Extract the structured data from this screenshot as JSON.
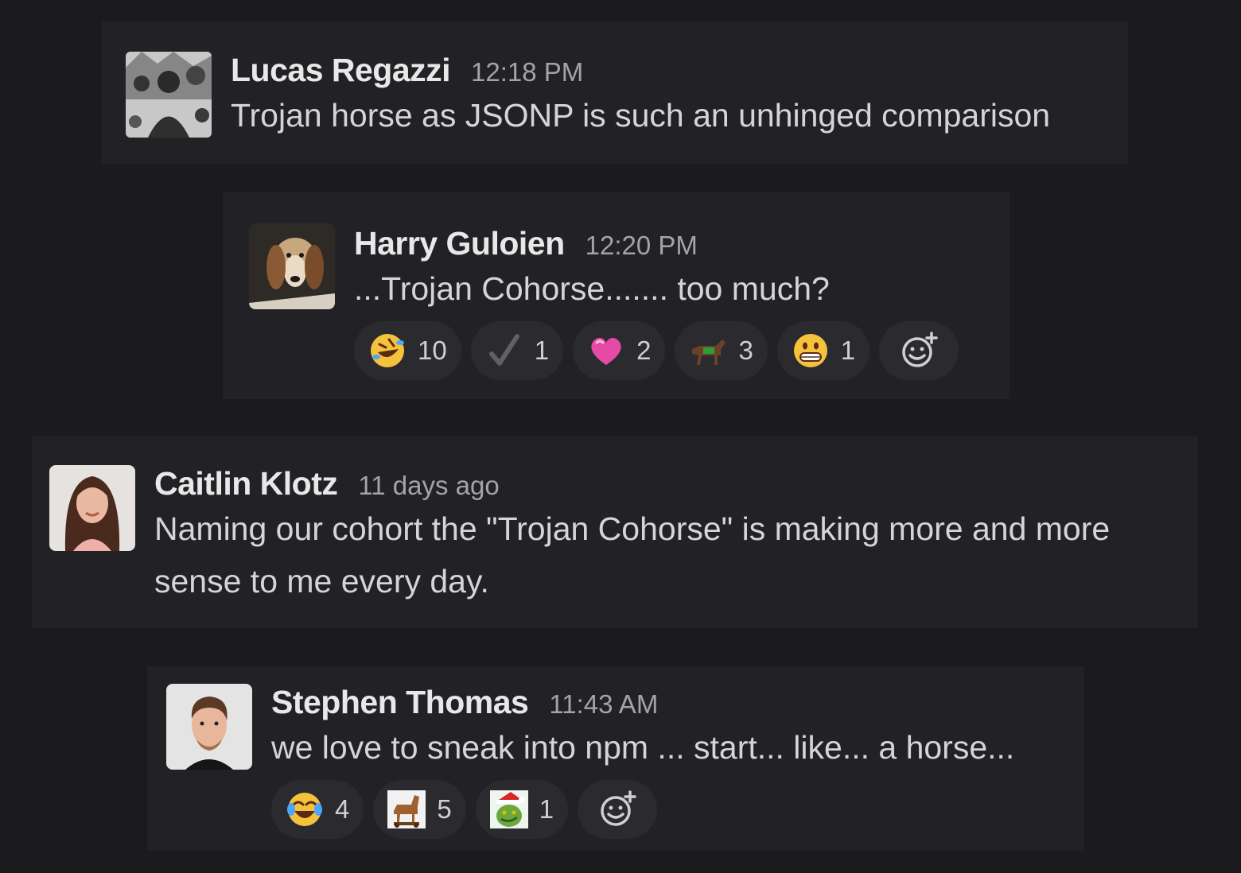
{
  "messages": [
    {
      "author": "Lucas Regazzi",
      "time": "12:18 PM",
      "text": "Trojan horse as JSONP is such an unhinged comparison",
      "avatar_icon": "bw-photo-avatar"
    },
    {
      "author": "Harry Guloien",
      "time": "12:20 PM",
      "text": "...Trojan Cohorse....... too much?",
      "avatar_icon": "dog-avatar",
      "reactions": [
        {
          "icon": "rofl-icon",
          "count": "10"
        },
        {
          "icon": "checkmark-icon",
          "count": "1"
        },
        {
          "icon": "pink-heart-icon",
          "count": "2"
        },
        {
          "icon": "horse-icon",
          "count": "3"
        },
        {
          "icon": "grinning-face-icon",
          "count": "1"
        }
      ]
    },
    {
      "author": "Caitlin Klotz",
      "time": "11 days ago",
      "text_line1": "Naming our cohort the \"Trojan Cohorse\" is making more and more",
      "text_line2": "sense to me every day.",
      "avatar_icon": "portrait-avatar"
    },
    {
      "author": "Stephen Thomas",
      "time": "11:43 AM",
      "text": "we love to sneak into npm ... start... like... a horse...",
      "avatar_icon": "portrait-avatar",
      "reactions": [
        {
          "icon": "joy-icon",
          "count": "4"
        },
        {
          "icon": "trojan-horse-icon",
          "count": "5"
        },
        {
          "icon": "grinch-icon",
          "count": "1"
        }
      ]
    }
  ],
  "colors": {
    "background": "#1b1b1d",
    "message_bg": "#222226",
    "reaction_bg": "#2b2b2f"
  }
}
